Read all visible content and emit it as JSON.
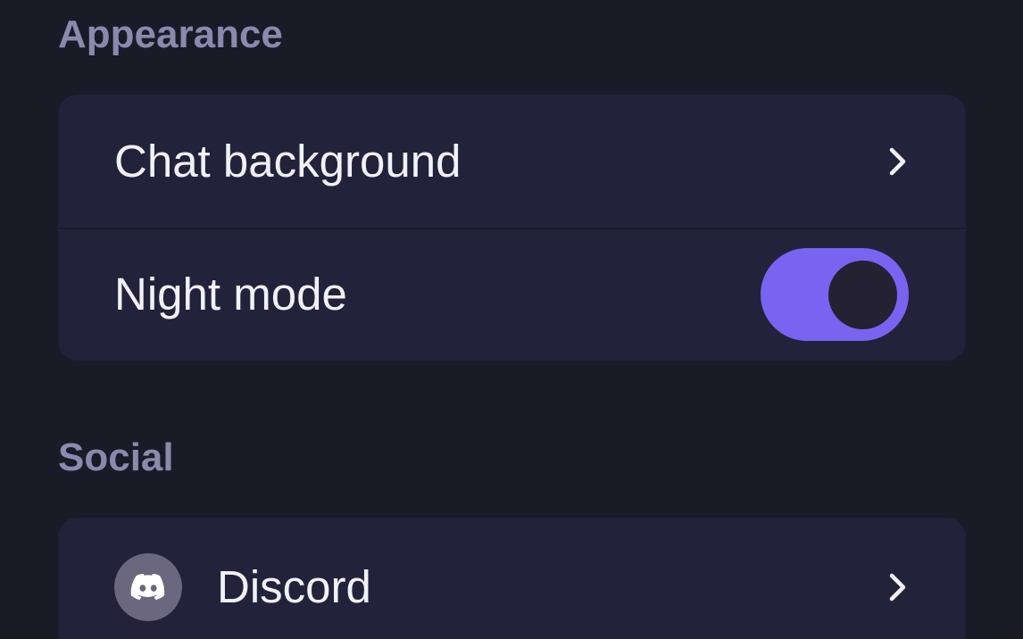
{
  "appearance": {
    "title": "Appearance",
    "chat_background": {
      "label": "Chat background",
      "icon": "chevron-right-icon"
    },
    "night_mode": {
      "label": "Night mode",
      "enabled": true
    }
  },
  "social": {
    "title": "Social",
    "discord": {
      "label": "Discord",
      "icon": "discord-icon",
      "chevron_icon": "chevron-right-icon"
    }
  },
  "colors": {
    "background": "#1b1a27",
    "card": "#24223a",
    "section_title": "#8d88ad",
    "text": "#f2f1f8",
    "accent": "#7a63f0"
  }
}
